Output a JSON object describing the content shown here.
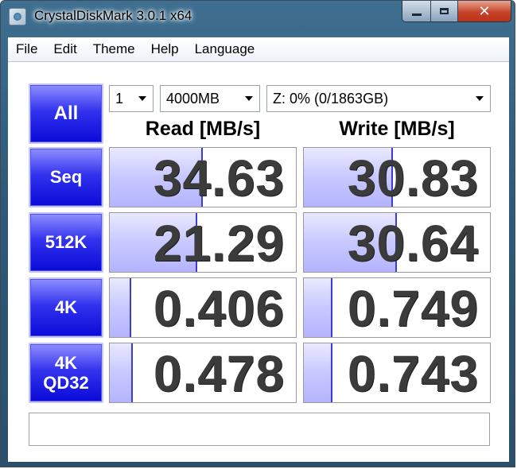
{
  "window": {
    "title": "CrystalDiskMark 3.0.1 x64"
  },
  "menu": [
    "File",
    "Edit",
    "Theme",
    "Help",
    "Language"
  ],
  "all_button": "All",
  "controls": {
    "count": "1",
    "size": "4000MB",
    "drive": "Z: 0% (0/1863GB)"
  },
  "headers": {
    "read": "Read [MB/s]",
    "write": "Write [MB/s]"
  },
  "rows": [
    {
      "label": [
        "Seq"
      ],
      "read": "34.63",
      "write": "30.83",
      "read_fill": 0.49,
      "write_fill": 0.47
    },
    {
      "label": [
        "512K"
      ],
      "read": "21.29",
      "write": "30.64",
      "read_fill": 0.46,
      "write_fill": 0.49
    },
    {
      "label": [
        "4K"
      ],
      "read": "0.406",
      "write": "0.749",
      "read_fill": 0.11,
      "write_fill": 0.15
    },
    {
      "label": [
        "4K",
        "QD32"
      ],
      "read": "0.478",
      "write": "0.743",
      "read_fill": 0.12,
      "write_fill": 0.15
    }
  ],
  "status": "",
  "colors": {
    "button": "#1a1ae0",
    "bar": "#c8c8ff",
    "bar_edge": "#3b3bd8",
    "value_text": "#3b3b3b"
  }
}
